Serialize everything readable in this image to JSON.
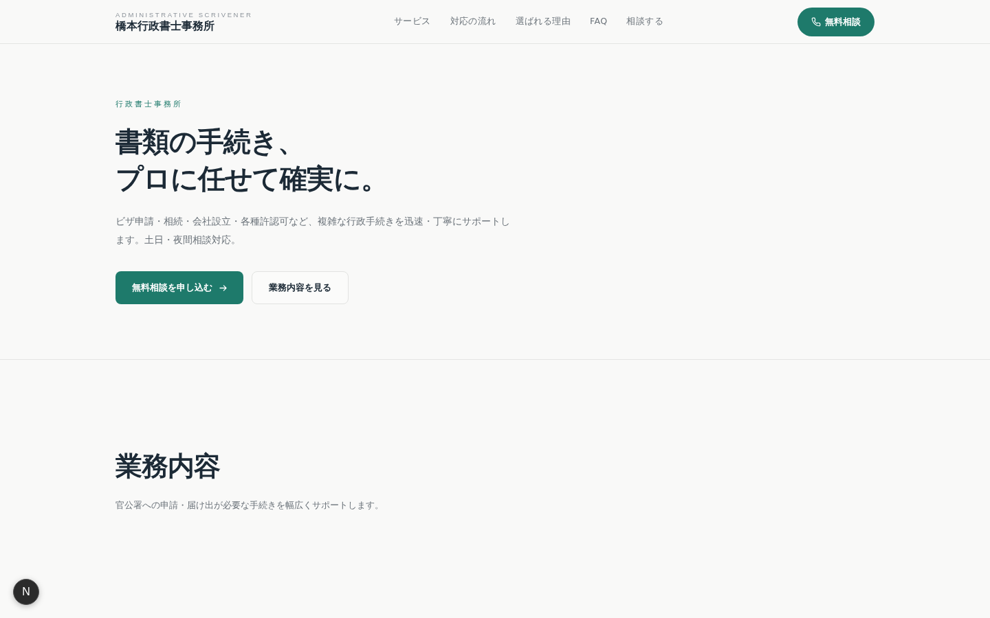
{
  "header": {
    "logo": {
      "tagline": "ADMINISTRATIVE SCRIVENER",
      "name": "橋本行政書士事務所"
    },
    "nav": [
      "サービス",
      "対応の流れ",
      "選ばれる理由",
      "FAQ",
      "相談する"
    ],
    "cta": {
      "label": "無料相談"
    }
  },
  "hero": {
    "eyebrow": "行政書士事務所",
    "title_lines": [
      "書類の手続き、",
      "プロに任せて確実に。"
    ],
    "lead": "ビザ申請・相続・会社設立・各種許認可など、複雑な行政手続きを迅速・丁寧にサポートします。土日・夜間相談対応。",
    "buttons": [
      {
        "label": "無料相談を申し込む",
        "kind": "primary"
      },
      {
        "label": "業務内容を見る",
        "kind": "secondary"
      }
    ]
  },
  "services": {
    "title": "業務内容",
    "subtitle": "官公署への申請・届け出が必要な手続きを幅広くサポートします。"
  },
  "dev_badge": {
    "label": "N"
  }
}
